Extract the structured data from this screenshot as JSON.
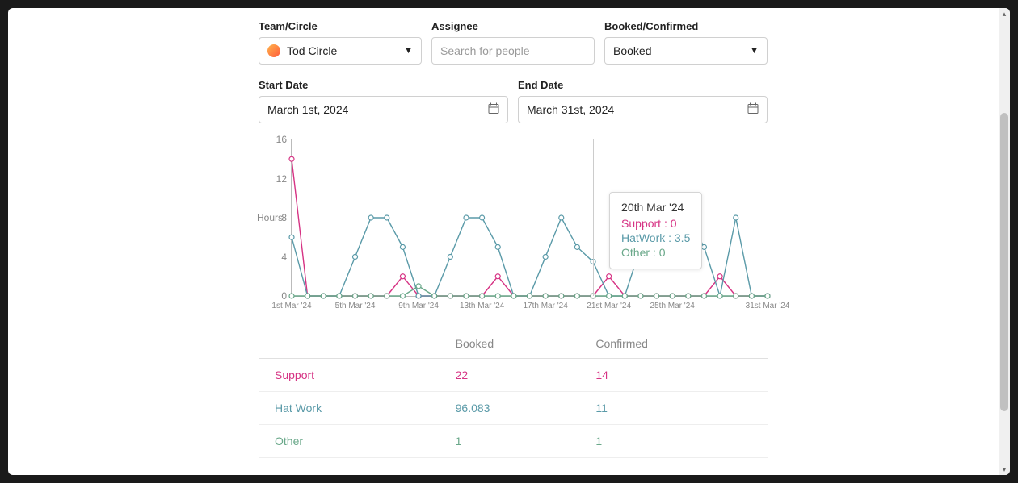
{
  "filters": {
    "team_label": "Team/Circle",
    "team_value": "Tod Circle",
    "assignee_label": "Assignee",
    "assignee_placeholder": "Search for people",
    "booked_label": "Booked/Confirmed",
    "booked_value": "Booked",
    "start_label": "Start Date",
    "start_value": "March 1st, 2024",
    "end_label": "End Date",
    "end_value": "March 31st, 2024"
  },
  "tooltip": {
    "date": "20th Mar '24",
    "rows": [
      {
        "label": "Support",
        "value": "0"
      },
      {
        "label": "HatWork",
        "value": "3.5"
      },
      {
        "label": "Other",
        "value": "0"
      }
    ]
  },
  "table": {
    "headers": [
      "",
      "Booked",
      "Confirmed"
    ],
    "rows": [
      {
        "name": "Support",
        "booked": "22",
        "confirmed": "14",
        "cls": "row-support"
      },
      {
        "name": "Hat Work",
        "booked": "96.083",
        "confirmed": "11",
        "cls": "row-hatwork"
      },
      {
        "name": "Other",
        "booked": "1",
        "confirmed": "1",
        "cls": "row-other"
      }
    ]
  },
  "chart_data": {
    "type": "line",
    "ylabel": "Hours",
    "ylim": [
      0,
      16
    ],
    "y_ticks": [
      0,
      4,
      8,
      12,
      16
    ],
    "x_ticks": [
      "1st Mar '24",
      "5th Mar '24",
      "9th Mar '24",
      "13th Mar '24",
      "17th Mar '24",
      "21st Mar '24",
      "25th Mar '24",
      "31st Mar '24"
    ],
    "x_tick_indices": [
      0,
      4,
      8,
      12,
      16,
      20,
      24,
      30
    ],
    "categories": [
      "1",
      "2",
      "3",
      "4",
      "5",
      "6",
      "7",
      "8",
      "9",
      "10",
      "11",
      "12",
      "13",
      "14",
      "15",
      "16",
      "17",
      "18",
      "19",
      "20",
      "21",
      "22",
      "23",
      "24",
      "25",
      "26",
      "27",
      "28",
      "29",
      "30",
      "31"
    ],
    "series": [
      {
        "name": "Support",
        "color": "#d63384",
        "values": [
          14,
          0,
          0,
          0,
          0,
          0,
          0,
          2,
          0,
          0,
          0,
          0,
          0,
          2,
          0,
          0,
          0,
          0,
          0,
          0,
          2,
          0,
          0,
          0,
          0,
          0,
          0,
          2,
          0,
          0,
          0
        ]
      },
      {
        "name": "HatWork",
        "color": "#5a9aa8",
        "values": [
          6,
          0,
          0,
          0,
          4,
          8,
          8,
          5,
          0,
          0,
          4,
          8,
          8,
          5,
          0,
          0,
          4,
          8,
          5,
          3.5,
          0,
          0,
          5,
          4,
          8,
          8,
          5,
          0,
          8,
          0,
          0
        ]
      },
      {
        "name": "Other",
        "color": "#6aa88a",
        "values": [
          0,
          0,
          0,
          0,
          0,
          0,
          0,
          0,
          1,
          0,
          0,
          0,
          0,
          0,
          0,
          0,
          0,
          0,
          0,
          0,
          0,
          0,
          0,
          0,
          0,
          0,
          0,
          0,
          0,
          0,
          0
        ]
      }
    ],
    "hover_index": 19
  }
}
